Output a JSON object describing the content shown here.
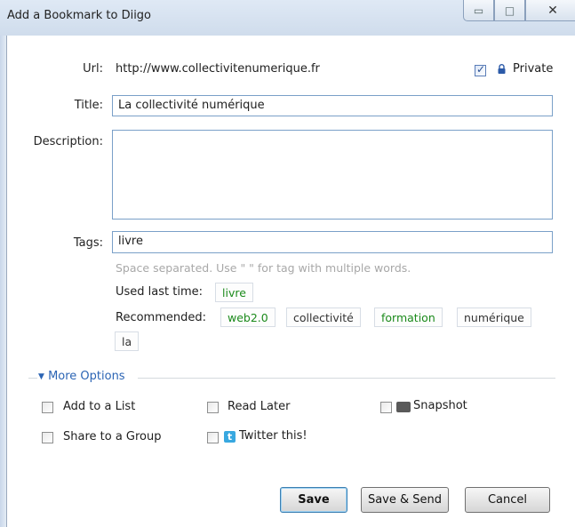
{
  "window": {
    "title": "Add a Bookmark to Diigo"
  },
  "form": {
    "url_label": "Url:",
    "url_value": "http://www.collectivitenumerique.fr",
    "private_label": "Private",
    "title_label": "Title:",
    "title_value": "La collectivité numérique",
    "description_label": "Description:",
    "description_value": "",
    "tags_label": "Tags:",
    "tags_value": "livre",
    "tags_hint": "Space separated. Use \" \" for tag with multiple words.",
    "used_last_time_label": "Used last time:",
    "used_last_time_tags": [
      "livre"
    ],
    "recommended_label": "Recommended:",
    "recommended_tags": [
      "web2.0",
      "collectivité",
      "formation",
      "numérique",
      "la"
    ]
  },
  "more_options": {
    "label": "More Options",
    "add_to_list": "Add to a List",
    "read_later": "Read Later",
    "snapshot": "Snapshot",
    "share_to_group": "Share to a Group",
    "twitter_this": "Twitter this!"
  },
  "buttons": {
    "save": "Save",
    "save_send": "Save & Send",
    "cancel": "Cancel"
  },
  "colors": {
    "accent": "#2b64b4",
    "tag_green": "#1b8a1b",
    "twitter": "#38a8e0"
  }
}
